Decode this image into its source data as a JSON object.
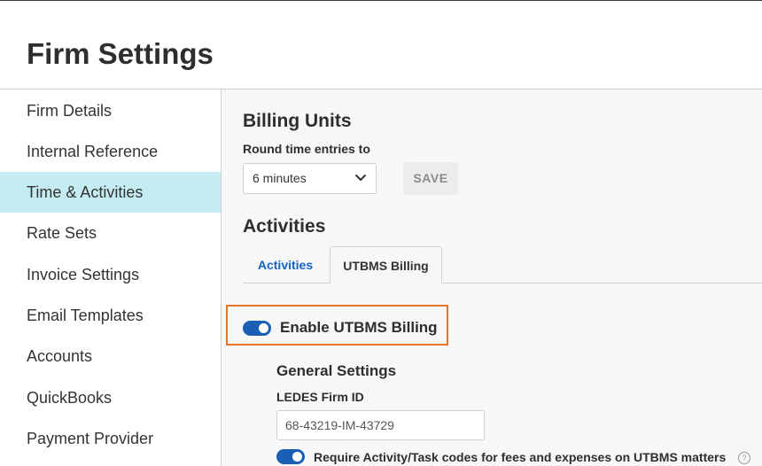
{
  "header": {
    "title": "Firm Settings"
  },
  "sidebar": {
    "items": [
      {
        "label": "Firm Details"
      },
      {
        "label": "Internal Reference"
      },
      {
        "label": "Time & Activities",
        "active": true
      },
      {
        "label": "Rate Sets"
      },
      {
        "label": "Invoice Settings"
      },
      {
        "label": "Email Templates"
      },
      {
        "label": "Accounts"
      },
      {
        "label": "QuickBooks"
      },
      {
        "label": "Payment Provider"
      }
    ]
  },
  "billing_units": {
    "heading": "Billing Units",
    "round_label": "Round time entries to",
    "round_value": "6 minutes",
    "save_label": "SAVE"
  },
  "activities": {
    "heading": "Activities",
    "tabs": [
      {
        "label": "Activities"
      },
      {
        "label": "UTBMS Billing",
        "selected": true
      }
    ]
  },
  "utbms": {
    "enable_label": "Enable UTBMS Billing",
    "enabled": true,
    "general_heading": "General Settings",
    "firm_id_label": "LEDES Firm ID",
    "firm_id_value": "68-43219-IM-43729",
    "require_codes_label": "Require Activity/Task codes for fees and expenses on UTBMS matters",
    "require_codes_enabled": true,
    "help_glyph": "?"
  },
  "colors": {
    "active_nav": "#c6ecf3",
    "accent": "#1a5fb4",
    "tab_link": "#1565c0",
    "highlight_border": "#e8742a"
  }
}
